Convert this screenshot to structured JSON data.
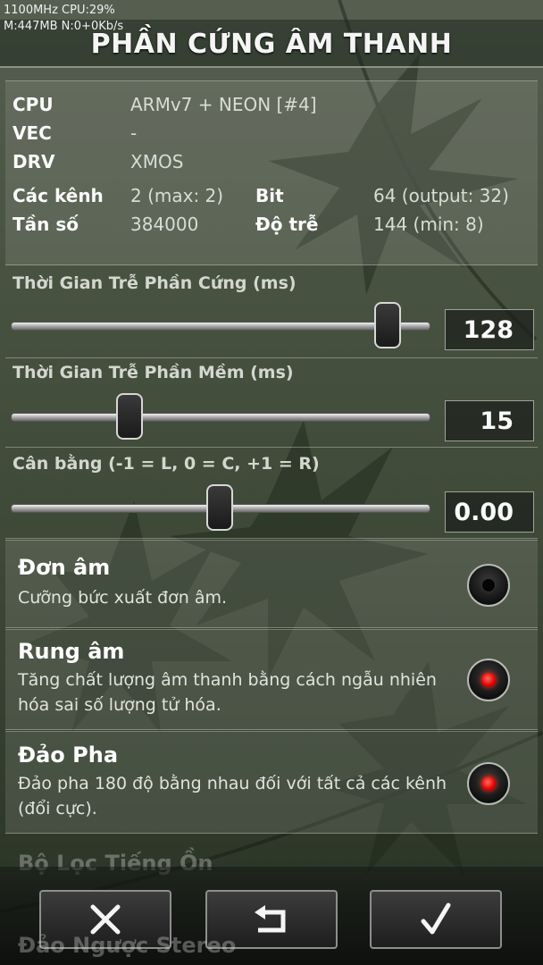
{
  "status_bar": {
    "line1": "1100MHz CPU:29%",
    "line2": "M:447MB N:0+0Kb/s"
  },
  "header": {
    "title": "PHẦN CỨNG ÂM THANH"
  },
  "info": {
    "cpu": {
      "label": "CPU",
      "value": "ARMv7 + NEON [#4]"
    },
    "vec": {
      "label": "VEC",
      "value": "-"
    },
    "drv": {
      "label": "DRV",
      "value": "XMOS"
    },
    "channels": {
      "label": "Các kênh",
      "value": "2 (max: 2)"
    },
    "bit": {
      "label": "Bit",
      "value": "64 (output: 32)"
    },
    "frequency": {
      "label": "Tần số",
      "value": "384000"
    },
    "latency": {
      "label": "Độ trễ",
      "value": "144 (min: 8)"
    }
  },
  "sliders": {
    "hw_delay": {
      "label": "Thời Gian Trễ Phần Cứng (ms)",
      "value": "128",
      "position": 0.93
    },
    "sw_delay": {
      "label": "Thời Gian Trễ Phần Mềm (ms)",
      "value": "15",
      "position": 0.27
    },
    "balance": {
      "label": "Cân bằng (-1 = L, 0 = C, +1 = R)",
      "value": "0.00",
      "position": 0.5
    }
  },
  "options": {
    "mono": {
      "title": "Đơn âm",
      "desc": "Cưỡng bức xuất đơn âm.",
      "enabled": false
    },
    "dither": {
      "title": "Rung âm",
      "desc": "Tăng chất lượng âm thanh bằng cách ngẫu nhiên hóa sai số lượng tử hóa.",
      "enabled": true
    },
    "phase": {
      "title": "Đảo Pha",
      "desc": "Đảo pha 180 độ bằng nhau đối với tất cả các kênh (đổi cực).",
      "enabled": true
    },
    "noise": {
      "title": "Bộ Lọc Tiếng Ồn"
    },
    "stereo": {
      "title": "Đảo Ngược Stereo"
    }
  },
  "footer": {
    "cancel_icon": "close-icon",
    "back_icon": "return-arrow-icon",
    "ok_icon": "checkmark-icon"
  },
  "colors": {
    "accent_on": "#e00000",
    "text": "#ffffff"
  }
}
